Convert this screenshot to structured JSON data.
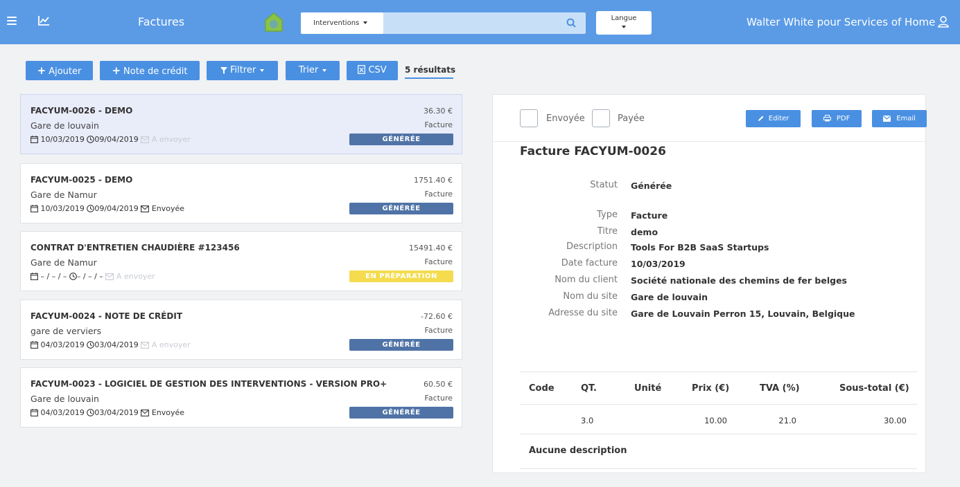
{
  "topbar": {
    "title": "Factures",
    "search_scope": "Interventions",
    "search_placeholder": "",
    "language_label": "Langue",
    "user": "Walter White pour Services of Home"
  },
  "toolbar": {
    "add": "Ajouter",
    "credit_note": "Note de crédit",
    "filter": "Filtrer",
    "sort": "Trier",
    "csv": "CSV",
    "results": "5 résultats"
  },
  "invoices": [
    {
      "title": "FACYUM-0026 - DEMO",
      "site": "Gare de louvain",
      "date": "10/03/2019",
      "due": "09/04/2019",
      "send_status": "A envoyer",
      "sent": false,
      "amount": "36.30 €",
      "type": "Facture",
      "status": "GÉNÉRÉE"
    },
    {
      "title": "FACYUM-0025 - DEMO",
      "site": "Gare de Namur",
      "date": "10/03/2019",
      "due": "09/04/2019",
      "send_status": "Envoyée",
      "sent": true,
      "amount": "1751.40 €",
      "type": "Facture",
      "status": "GÉNÉRÉE"
    },
    {
      "title": "CONTRAT D'ENTRETIEN CHAUDIÈRE #123456",
      "site": "Gare de Namur",
      "date": "– / – / –",
      "due": "– / – / –",
      "send_status": "A envoyer",
      "sent": false,
      "amount": "15491.40 €",
      "type": "Facture",
      "status": "EN PRÉPARATION"
    },
    {
      "title": "FACYUM-0024 - NOTE DE CRÉDIT",
      "site": "gare de verviers",
      "date": "04/03/2019",
      "due": "03/04/2019",
      "send_status": "A envoyer",
      "sent": false,
      "amount": "-72.60 €",
      "type": "Facture",
      "status": "GÉNÉRÉE"
    },
    {
      "title": "FACYUM-0023 - LOGICIEL DE GESTION DES INTERVENTIONS - VERSION PRO+",
      "site": "Gare de louvain",
      "date": "04/03/2019",
      "due": "03/04/2019",
      "send_status": "Envoyée",
      "sent": true,
      "amount": "60.50 €",
      "type": "Facture",
      "status": "GÉNÉRÉE"
    }
  ],
  "detail": {
    "sent_label": "Envoyée",
    "paid_label": "Payée",
    "edit": "Editer",
    "pdf": "PDF",
    "email": "Email",
    "title": "Facture FACYUM-0026",
    "status_label": "Statut",
    "status_value": "Générée",
    "fields": [
      {
        "label": "Type",
        "value": "Facture"
      },
      {
        "label": "Titre",
        "value": "demo"
      },
      {
        "label": "Description",
        "value": "Tools For B2B SaaS Startups"
      },
      {
        "label": "Date facture",
        "value": "10/03/2019"
      },
      {
        "label": "Nom du client",
        "value": "Société nationale des chemins de fer belges"
      },
      {
        "label": "Nom du site",
        "value": "Gare de louvain"
      },
      {
        "label": "Adresse du site",
        "value": "Gare de Louvain Perron 15, Louvain, Belgique"
      }
    ],
    "table_headers": [
      "Code",
      "QT.",
      "Unité",
      "Prix (€)",
      "TVA (%)",
      "Sous-total (€)"
    ],
    "table_row": [
      "",
      "3.0",
      "",
      "10.00",
      "21.0",
      "30.00"
    ],
    "no_description": "Aucune description"
  },
  "colors": {
    "primary": "#4a90e2",
    "topbar": "#5b9be6",
    "badge_generated": "#4f73a6",
    "badge_preparation": "#f4dc4e"
  }
}
